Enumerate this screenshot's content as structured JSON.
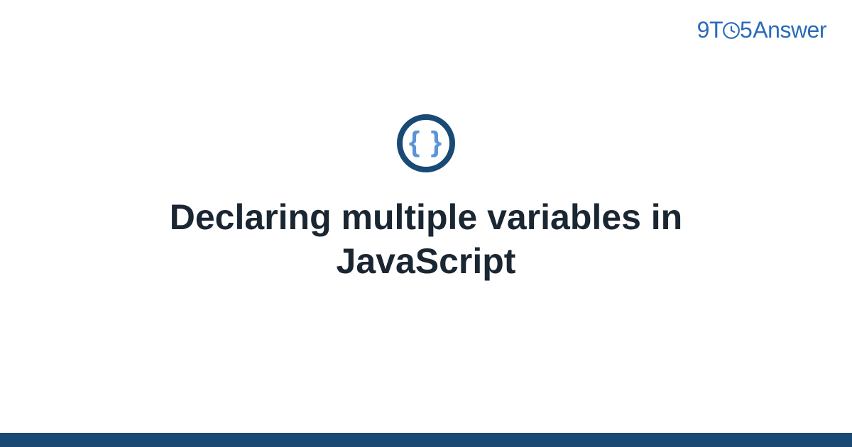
{
  "logo": {
    "part1": "9",
    "part2": "T",
    "part3": "5",
    "part4": "Answer"
  },
  "icon": {
    "name": "code-braces-icon",
    "glyph": "{ }"
  },
  "title": "Declaring multiple variables in JavaScript",
  "colors": {
    "brand_blue": "#2a6bb8",
    "dark_navy": "#194975",
    "light_blue": "#5b95d6",
    "text_dark": "#1a2632"
  }
}
